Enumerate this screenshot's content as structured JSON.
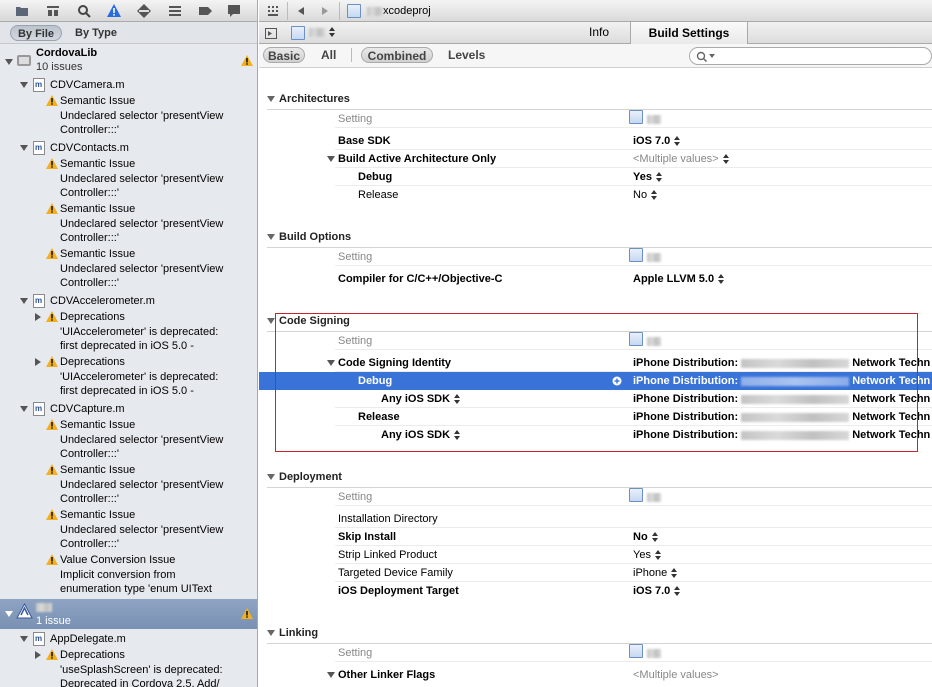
{
  "navigator": {
    "filter_tabs": [
      "By File",
      "By Type"
    ],
    "groups": [
      {
        "name": "CordovaLib",
        "count": "10 issues"
      },
      {
        "name": "",
        "count": "1 issue"
      }
    ],
    "files": [
      "CDVCamera.m",
      "CDVContacts.m",
      "CDVAccelerometer.m",
      "CDVCapture.m",
      "AppDelegate.m"
    ],
    "semantic_issue": "Semantic Issue",
    "undeclared_l1": "Undeclared selector 'presentView",
    "undeclared_l2": "Controller:::'",
    "deprecations": "Deprecations",
    "accel_l1": "'UIAccelerometer' is deprecated:",
    "accel_l2": "first deprecated in iOS 5.0 -",
    "value_conv": "Value Conversion Issue",
    "valconv_l1": "Implicit conversion from",
    "valconv_l2": "enumeration type 'enum UIText",
    "splash_l1": "'useSplashScreen' is deprecated:",
    "splash_l2": "Deprecated in Cordova 2.5. Add/"
  },
  "editor": {
    "breadcrumb_file": "xcodeproj",
    "tabs": [
      "Info",
      "Build Settings"
    ],
    "options": [
      "Basic",
      "All",
      "Combined",
      "Levels"
    ],
    "setting_col": "Setting",
    "sections": {
      "architectures": "Architectures",
      "build_options": "Build Options",
      "code_signing": "Code Signing",
      "deployment": "Deployment",
      "linking": "Linking"
    },
    "rows": {
      "base_sdk": {
        "name": "Base SDK",
        "value": "iOS 7.0"
      },
      "build_active": {
        "name": "Build Active Architecture Only",
        "value": "<Multiple values>"
      },
      "debug_arch": {
        "name": "Debug",
        "value": "Yes"
      },
      "release_arch": {
        "name": "Release",
        "value": "No"
      },
      "compiler": {
        "name": "Compiler for C/C++/Objective-C",
        "value": "Apple LLVM 5.0"
      },
      "csi": {
        "name": "Code Signing Identity",
        "value": "iPhone Distribution:"
      },
      "csi_debug": {
        "name": "Debug",
        "value": "iPhone Distribution:"
      },
      "csi_debug_any": {
        "name": "Any iOS SDK",
        "value": "iPhone Distribution:"
      },
      "csi_release": {
        "name": "Release",
        "value": "iPhone Distribution:"
      },
      "csi_release_any": {
        "name": "Any iOS SDK",
        "value": "iPhone Distribution:"
      },
      "install_dir": {
        "name": "Installation Directory",
        "value": ""
      },
      "skip_install": {
        "name": "Skip Install",
        "value": "No"
      },
      "strip": {
        "name": "Strip Linked Product",
        "value": "Yes"
      },
      "device_family": {
        "name": "Targeted Device Family",
        "value": "iPhone"
      },
      "deploy_target": {
        "name": "iOS Deployment Target",
        "value": "iOS 7.0"
      },
      "other_linker": {
        "name": "Other Linker Flags",
        "value": "<Multiple values>"
      }
    },
    "cs_trail": "Network Techn"
  }
}
